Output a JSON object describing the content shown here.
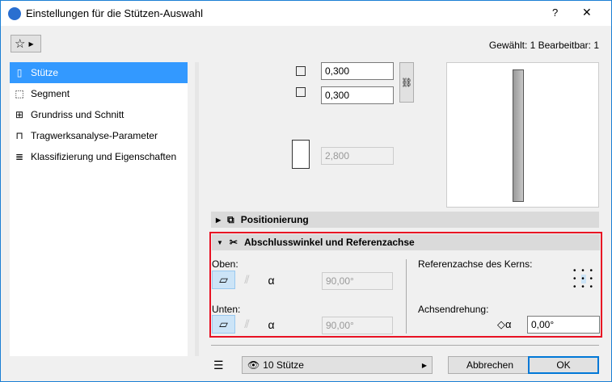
{
  "window": {
    "title": "Einstellungen für die Stützen-Auswahl",
    "help": "?",
    "close": "✕"
  },
  "status": "Gewählt: 1 Bearbeitbar: 1",
  "sidebar": {
    "items": [
      {
        "label": "Stütze",
        "icon": "column-icon"
      },
      {
        "label": "Segment",
        "icon": "segment-icon"
      },
      {
        "label": "Grundriss und Schnitt",
        "icon": "floorplan-icon"
      },
      {
        "label": "Tragwerksanalyse-Parameter",
        "icon": "structural-icon"
      },
      {
        "label": "Klassifizierung und Eigenschaften",
        "icon": "document-icon"
      }
    ]
  },
  "dimensions": {
    "width": "0,300",
    "depth": "0,300",
    "height": "2,800"
  },
  "sections": {
    "positioning": "Positionierung",
    "end_angle": "Abschlusswinkel und Referenzachse"
  },
  "end_angle": {
    "top_label": "Oben:",
    "top_value": "90,00°",
    "bottom_label": "Unten:",
    "bottom_value": "90,00°",
    "ref_axis_label": "Referenzachse des Kerns:",
    "rotation_label": "Achsendrehung:",
    "rotation_value": "0,00°"
  },
  "footer": {
    "layer": "10 Stütze",
    "cancel": "Abbrechen",
    "ok": "OK"
  },
  "colors": {
    "accent": "#3399ff",
    "highlight": "#e81123"
  }
}
